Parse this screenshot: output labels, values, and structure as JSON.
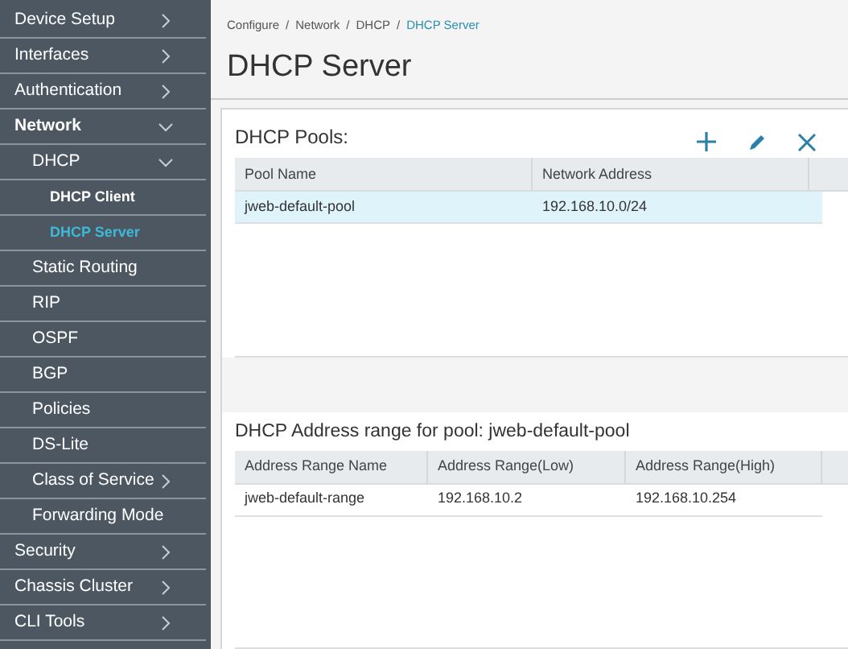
{
  "sidebar": {
    "items": [
      {
        "label": "Device Setup",
        "expanded": false
      },
      {
        "label": "Interfaces",
        "expanded": false
      },
      {
        "label": "Authentication",
        "expanded": false
      },
      {
        "label": "Network",
        "expanded": true,
        "children": [
          {
            "label": "DHCP",
            "expanded": true,
            "children": [
              {
                "label": "DHCP Client",
                "selected": false
              },
              {
                "label": "DHCP Server",
                "selected": true
              }
            ]
          },
          {
            "label": "Static Routing"
          },
          {
            "label": "RIP"
          },
          {
            "label": "OSPF"
          },
          {
            "label": "BGP"
          },
          {
            "label": "Policies"
          },
          {
            "label": "DS-Lite"
          },
          {
            "label": "Class of Service",
            "expanded": false
          },
          {
            "label": "Forwarding Mode"
          }
        ]
      },
      {
        "label": "Security",
        "expanded": false
      },
      {
        "label": "Chassis Cluster",
        "expanded": false
      },
      {
        "label": "CLI Tools",
        "expanded": false
      }
    ]
  },
  "breadcrumb": [
    "Configure",
    "Network",
    "DHCP",
    "DHCP Server"
  ],
  "breadcrumb_separator": "/",
  "page_title": "DHCP Server",
  "pools": {
    "title": "DHCP Pools:",
    "columns": [
      "Pool Name",
      "Network Address"
    ],
    "rows": [
      {
        "cells": [
          "jweb-default-pool",
          "192.168.10.0/24"
        ],
        "selected": true
      }
    ]
  },
  "ranges": {
    "title": "DHCP Address range for pool: jweb-default-pool",
    "columns": [
      "Address Range Name",
      "Address Range(Low)",
      "Address Range(High)"
    ],
    "rows": [
      {
        "cells": [
          "jweb-default-range",
          "192.168.10.2",
          "192.168.10.254"
        ],
        "selected": false
      }
    ]
  }
}
